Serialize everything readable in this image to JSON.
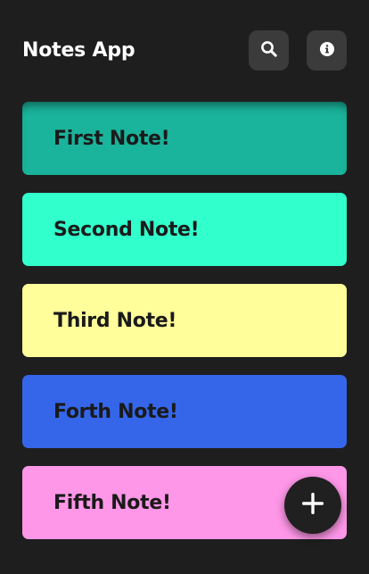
{
  "header": {
    "title": "Notes App",
    "search_icon": "search-icon",
    "info_icon": "info-icon"
  },
  "notes": [
    {
      "title": "First Note!",
      "color": "#1ab39b"
    },
    {
      "title": "Second Note!",
      "color": "#31ffcc"
    },
    {
      "title": "Third Note!",
      "color": "#fffe9a"
    },
    {
      "title": "Forth Note!",
      "color": "#3566e9"
    },
    {
      "title": "Fifth Note!",
      "color": "#ff97e8"
    }
  ],
  "fab": {
    "icon": "plus-icon"
  },
  "colors": {
    "background": "#1e1e1f",
    "icon_button": "#3b3b3b",
    "fab": "#202020"
  }
}
